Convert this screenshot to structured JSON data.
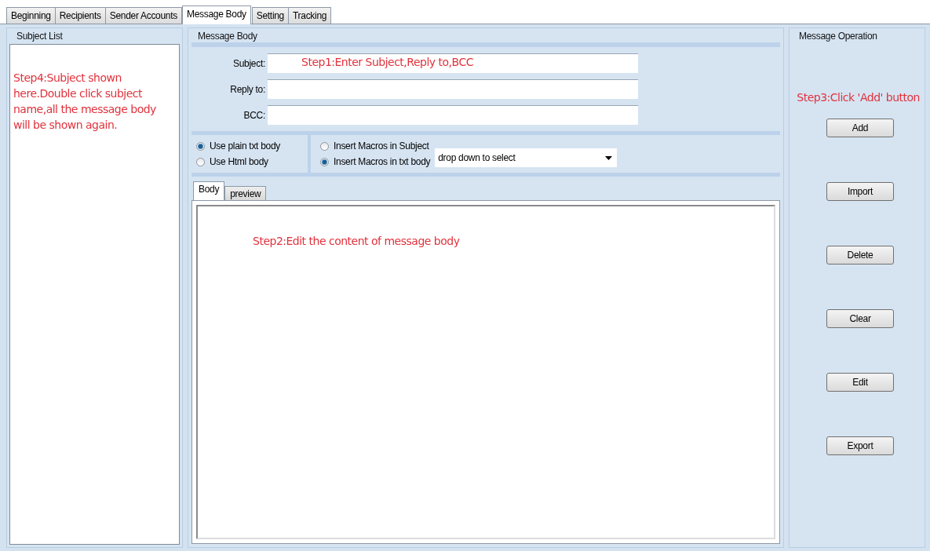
{
  "tabs": [
    {
      "label": "Beginning",
      "selected": false
    },
    {
      "label": "Recipients",
      "selected": false
    },
    {
      "label": "Sender Accounts",
      "selected": false
    },
    {
      "label": "Message Body",
      "selected": true
    },
    {
      "label": "Setting",
      "selected": false
    },
    {
      "label": "Tracking",
      "selected": false
    }
  ],
  "subject_list": {
    "title": "Subject List",
    "annotation": "Step4:Subject shown here.Double click subject name,all the message body will be shown again."
  },
  "message_body": {
    "title": "Message Body",
    "annotation": "Step1:Enter Subject,Reply to,BCC",
    "fields": [
      {
        "label": "Subject:"
      },
      {
        "label": "Reply to:"
      },
      {
        "label": "BCC:"
      }
    ],
    "body_format": [
      {
        "label": "Use plain txt body",
        "selected": true
      },
      {
        "label": "Use Html body",
        "selected": false
      }
    ],
    "macro_target": [
      {
        "label": "Insert Macros in Subject",
        "selected": false
      },
      {
        "label": "Insert Macros in txt body",
        "selected": true
      }
    ],
    "macro_dropdown": {
      "value": "drop down to select"
    },
    "editor_tabs": [
      {
        "label": "Body",
        "selected": true
      },
      {
        "label": "preview",
        "selected": false
      }
    ],
    "editor_annotation": "Step2:Edit the content of message body"
  },
  "message_operation": {
    "title": "Message Operation",
    "annotation": "Step3:Click 'Add' button",
    "buttons": [
      "Add",
      "Import",
      "Delete",
      "Clear",
      "Edit",
      "Export"
    ]
  }
}
